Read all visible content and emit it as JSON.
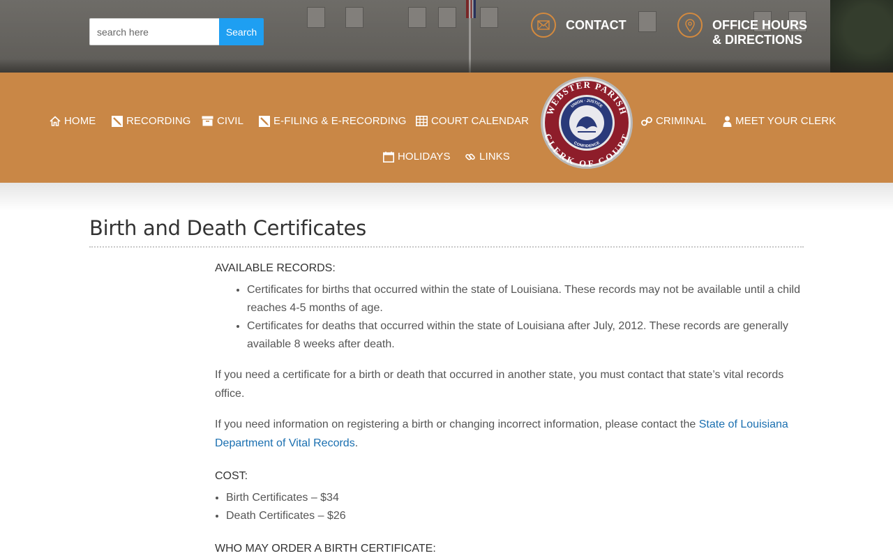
{
  "header": {
    "search": {
      "placeholder": "search here",
      "button_label": "Search"
    },
    "contact": {
      "label": "CONTACT",
      "icon": "envelope-icon"
    },
    "hours": {
      "line1": "OFFICE HOURS",
      "line2": "& DIRECTIONS",
      "icon": "location-pin-icon"
    }
  },
  "nav": {
    "items": [
      {
        "label": "HOME",
        "icon": "home-icon"
      },
      {
        "label": "RECORDING",
        "icon": "pencil-icon"
      },
      {
        "label": "CIVIL",
        "icon": "archive-box-icon"
      },
      {
        "label": "E-FILING & E-RECORDING",
        "icon": "pencil-icon"
      },
      {
        "label": "COURT CALENDAR",
        "icon": "table-icon"
      },
      {
        "label": "CRIMINAL",
        "icon": "handcuffs-icon"
      },
      {
        "label": "MEET YOUR CLERK",
        "icon": "user-icon"
      },
      {
        "label": "HOLIDAYS",
        "icon": "calendar-icon"
      },
      {
        "label": "LINKS",
        "icon": "link-icon"
      }
    ],
    "seal": {
      "top_text": "WEBSTER PARISH",
      "bottom_text": "CLERK OF COURT",
      "inner_top": "UNION · JUSTICE",
      "inner_bottom": "CONFIDENCE"
    }
  },
  "colors": {
    "nav_orange": "#c98746",
    "search_blue": "#1e9ff2",
    "link_blue": "#1a6fb0",
    "icon_ring": "#d48a3e"
  },
  "page": {
    "title": "Birth and Death Certificates",
    "available_heading": "AVAILABLE RECORDS:",
    "available_items": [
      "Certificates for births that occurred within the state of Louisiana.  These records may not be available until a child reaches 4-5 months of age.",
      "Certificates for deaths that occurred within the state of Louisiana after July, 2012.  These records are generally available 8 weeks after death."
    ],
    "other_state_text": "If you need a certificate for a birth or death that occurred in another state, you must contact that state’s vital records office.",
    "register_text": "If you need information on registering a birth or changing incorrect information, please contact the ",
    "register_link": "State of Louisiana Department of Vital Records",
    "register_tail": ".",
    "cost_heading": "COST:",
    "cost_items": [
      "Birth Certificates – $34",
      "Death Certificates – $26"
    ],
    "who_heading": "WHO MAY ORDER A BIRTH CERTIFICATE:"
  }
}
